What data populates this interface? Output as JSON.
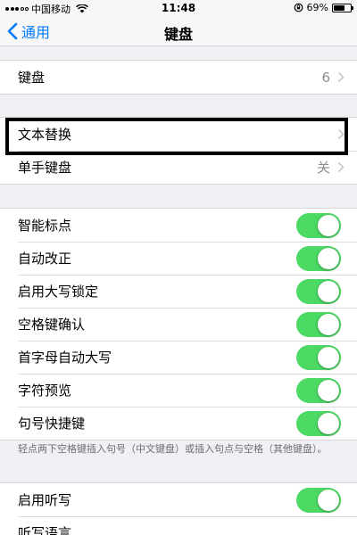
{
  "status_bar": {
    "carrier": "中国移动",
    "time": "11:48",
    "battery": "69%",
    "battery_level": 0.69
  },
  "nav": {
    "back_label": "通用",
    "title": "键盘"
  },
  "group1": {
    "rows": [
      {
        "label": "键盘",
        "value": "6"
      }
    ]
  },
  "group2": {
    "rows": [
      {
        "label": "文本替换",
        "value": ""
      },
      {
        "label": "单手键盘",
        "value": "关"
      }
    ]
  },
  "group3": {
    "rows": [
      {
        "label": "智能标点",
        "on": true
      },
      {
        "label": "自动改正",
        "on": true
      },
      {
        "label": "启用大写锁定",
        "on": true
      },
      {
        "label": "空格键确认",
        "on": true
      },
      {
        "label": "首字母自动大写",
        "on": true
      },
      {
        "label": "字符预览",
        "on": true
      },
      {
        "label": "句号快捷键",
        "on": true
      }
    ],
    "footer": "轻点两下空格键插入句号（中文键盘）或插入句点与空格（其他键盘）。"
  },
  "group4": {
    "rows": [
      {
        "label": "启用听写",
        "on": true
      },
      {
        "label": "听写语言"
      }
    ]
  },
  "colors": {
    "accent": "#007aff",
    "toggle_on": "#4cd964",
    "background": "#efeff4"
  }
}
